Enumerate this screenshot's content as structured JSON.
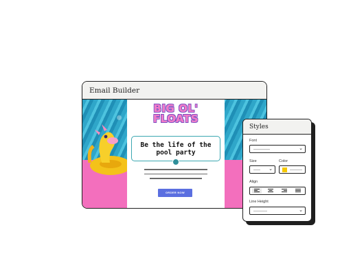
{
  "builder": {
    "title": "Email Builder",
    "email": {
      "logo_line1": "BIG OL'",
      "logo_line2": "FLOATS",
      "headline": "Be the life of the pool party",
      "button_label": "ORDER NOW"
    }
  },
  "styles_panel": {
    "title": "Styles",
    "font_label": "Font",
    "size_label": "Size",
    "color_label": "Color",
    "align_label": "Align",
    "line_height_label": "Line Height",
    "color_swatch": "#f5c800",
    "align_options": [
      "align-left-icon",
      "align-center-icon",
      "align-right-icon",
      "align-justify-icon"
    ]
  },
  "colors": {
    "pool": "#2fa6c9",
    "pink": "#f36fbd",
    "logo": "#f179c7",
    "button": "#5b6fe0",
    "headline_border": "#3aa7b1"
  }
}
